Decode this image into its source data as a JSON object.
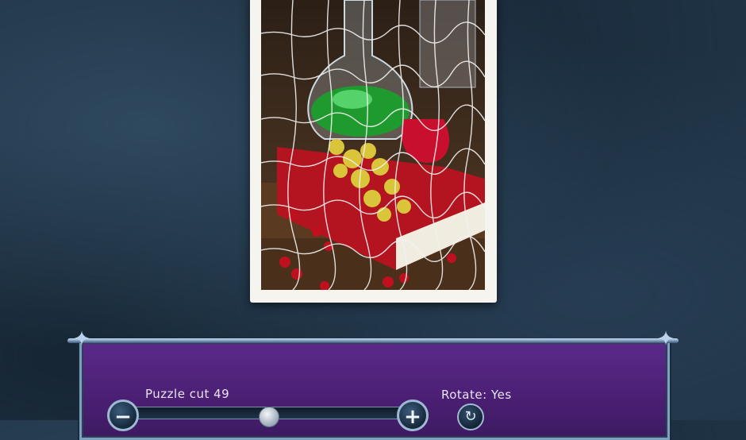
{
  "puzzle": {
    "cut_label": "Puzzle cut 49",
    "rotate_label": "Rotate: Yes"
  },
  "controls": {
    "minus_symbol": "−",
    "plus_symbol": "+",
    "rotate_symbol": "↻",
    "slider_value_fraction": 0.5
  },
  "colors": {
    "panel": "#4a1f73",
    "frame": "#f6f4ef",
    "accent": "#9fb9d3"
  }
}
